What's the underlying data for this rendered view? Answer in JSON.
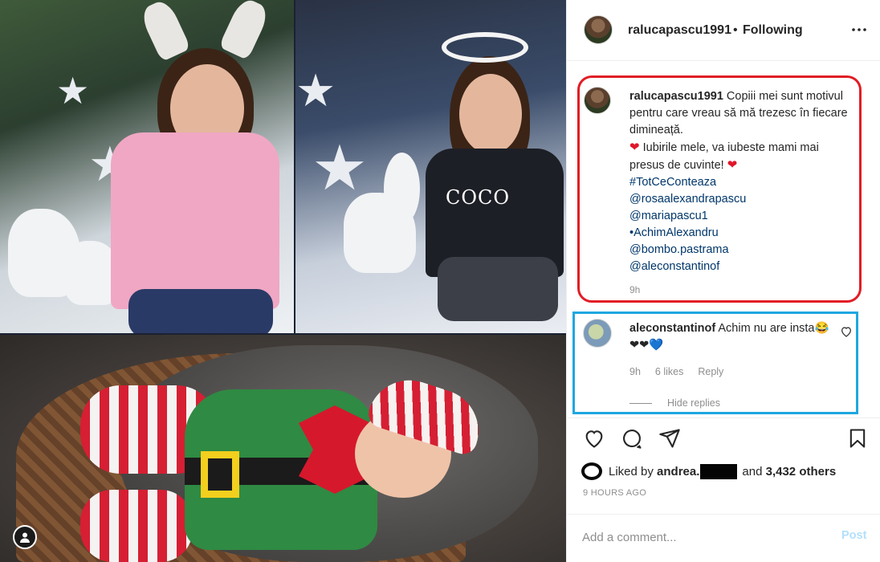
{
  "header": {
    "username": "ralucapascu1991",
    "separator": "•",
    "follow_status": "Following"
  },
  "media": {
    "shirt_text": "COCO"
  },
  "caption": {
    "username": "ralucapascu1991",
    "text_line1": "Copiii mei sunt motivul pentru care vreau să mă trezesc în fiecare dimineață.",
    "heart": "❤",
    "text_line2": "Iubirile mele, va iubeste mami mai presus de cuvinte!",
    "tags": [
      "#TotCeConteaza",
      "@rosaalexandrapascu",
      "@mariapascu1",
      "•AchimAlexandru",
      "@bombo.pastrama",
      "@aleconstantinof"
    ],
    "time": "9h"
  },
  "comment": {
    "username": "aleconstantinof",
    "text": "Achim nu are insta",
    "emojis": "😂❤❤💙",
    "time": "9h",
    "likes": "6 likes",
    "reply": "Reply",
    "hide_replies": "Hide replies"
  },
  "likes": {
    "prefix": "Liked by",
    "user": "andrea.",
    "suffix_and": "and",
    "others": "3,432 others"
  },
  "timeago": "9 HOURS AGO",
  "add_comment": {
    "placeholder": "Add a comment...",
    "post_label": "Post"
  },
  "colors": {
    "caption_highlight": "#e11d25",
    "comment_highlight": "#1fa7e0",
    "post_button_disabled": "#b2dffc"
  }
}
